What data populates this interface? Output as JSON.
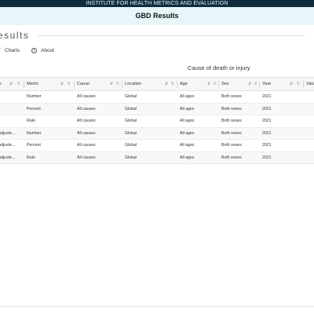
{
  "top_banner": "INSTITUTE FOR HEALTH METRICS AND EVALUATION",
  "window_title": "GBD Results",
  "page_heading": "esults",
  "tabs": [
    {
      "label": "Charts",
      "icon": "charts-icon"
    },
    {
      "label": "About",
      "icon": "info-icon"
    }
  ],
  "caption": "Cause of death or injury",
  "table": {
    "columns": [
      "Measure",
      "Metric",
      "Cause",
      "Location",
      "Age",
      "Sex",
      "Year",
      "Value"
    ],
    "rows": [
      [
        "",
        "Number",
        "All causes",
        "Global",
        "All ages",
        "Both sexes",
        "2021",
        ""
      ],
      [
        "",
        "Percent",
        "All causes",
        "Global",
        "All ages",
        "Both sexes",
        "2021",
        ""
      ],
      [
        "",
        "Rate",
        "All causes",
        "Global",
        "All ages",
        "Both sexes",
        "2021",
        ""
      ],
      [
        "-Adjuste...",
        "Number",
        "All causes",
        "Global",
        "All ages",
        "Both sexes",
        "2021",
        ""
      ],
      [
        "-Adjuste...",
        "Percent",
        "All causes",
        "Global",
        "All ages",
        "Both sexes",
        "2021",
        ""
      ],
      [
        "-Adjuste...",
        "Rate",
        "All causes",
        "Global",
        "All ages",
        "Both sexes",
        "2021",
        ""
      ]
    ]
  },
  "colors": {
    "banner_bg": "#0f2d3f",
    "title_bg": "#e8f6f9",
    "header_bg": "#f6f6f8",
    "alt_row_bg": "#f8f8fa"
  }
}
